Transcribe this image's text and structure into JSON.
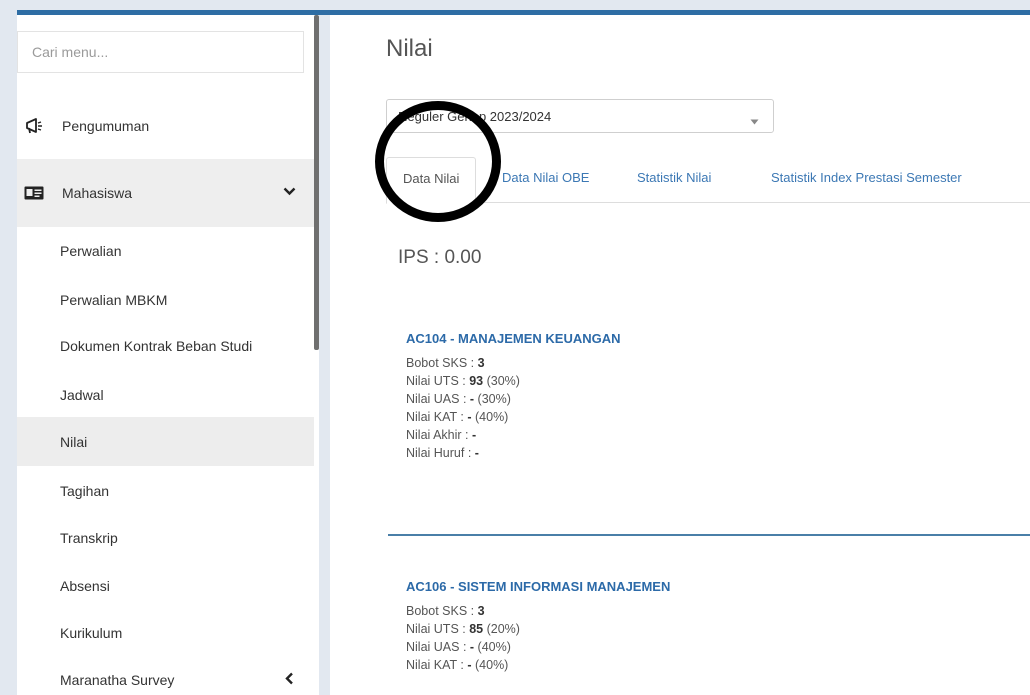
{
  "sidebar": {
    "search_placeholder": "Cari menu...",
    "pengumuman": "Pengumuman",
    "mahasiswa": "Mahasiswa",
    "items": [
      {
        "label": "Perwalian"
      },
      {
        "label": "Perwalian MBKM"
      },
      {
        "label": "Dokumen Kontrak Beban Studi"
      },
      {
        "label": "Jadwal"
      },
      {
        "label": "Nilai"
      },
      {
        "label": "Tagihan"
      },
      {
        "label": "Transkrip"
      },
      {
        "label": "Absensi"
      },
      {
        "label": "Kurikulum"
      },
      {
        "label": "Maranatha Survey"
      }
    ],
    "selected_item": "Nilai"
  },
  "main": {
    "title": "Nilai",
    "semester_select": "Reguler Genap 2023/2024",
    "tabs": [
      {
        "label": "Data Nilai",
        "active": true
      },
      {
        "label": "Data Nilai OBE",
        "active": false
      },
      {
        "label": "Statistik Nilai",
        "active": false
      },
      {
        "label": "Statistik Index Prestasi Semester",
        "active": false
      }
    ],
    "ips": "IPS : 0.00",
    "courses": [
      {
        "title": "AC104 - MANAJEMEN KEUANGAN",
        "bobot_label": "Bobot SKS : ",
        "bobot": "3",
        "uts_label": "Nilai UTS : ",
        "uts": "93",
        "uts_pct": " (30%)",
        "uas_label": "Nilai UAS : ",
        "uas": "-",
        "uas_pct": " (30%)",
        "kat_label": "Nilai KAT : ",
        "kat": "-",
        "kat_pct": " (40%)",
        "akhir_label": "Nilai Akhir : ",
        "akhir": "-",
        "huruf_label": "Nilai Huruf : ",
        "huruf": "-"
      },
      {
        "title": "AC106 - SISTEM INFORMASI MANAJEMEN",
        "bobot_label": "Bobot SKS : ",
        "bobot": "3",
        "uts_label": "Nilai UTS : ",
        "uts": "85",
        "uts_pct": " (20%)",
        "uas_label": "Nilai UAS : ",
        "uas": "-",
        "uas_pct": " (40%)",
        "kat_label": "Nilai KAT : ",
        "kat": "-",
        "kat_pct": " (40%)"
      }
    ]
  },
  "colors": {
    "accent": "#2e6da4",
    "link": "#3c78b4",
    "background": "#e2e8f0"
  },
  "icons": [
    "megaphone-icon",
    "id-card-icon",
    "chevron-down-icon",
    "chevron-left-icon",
    "caret-down-icon"
  ]
}
